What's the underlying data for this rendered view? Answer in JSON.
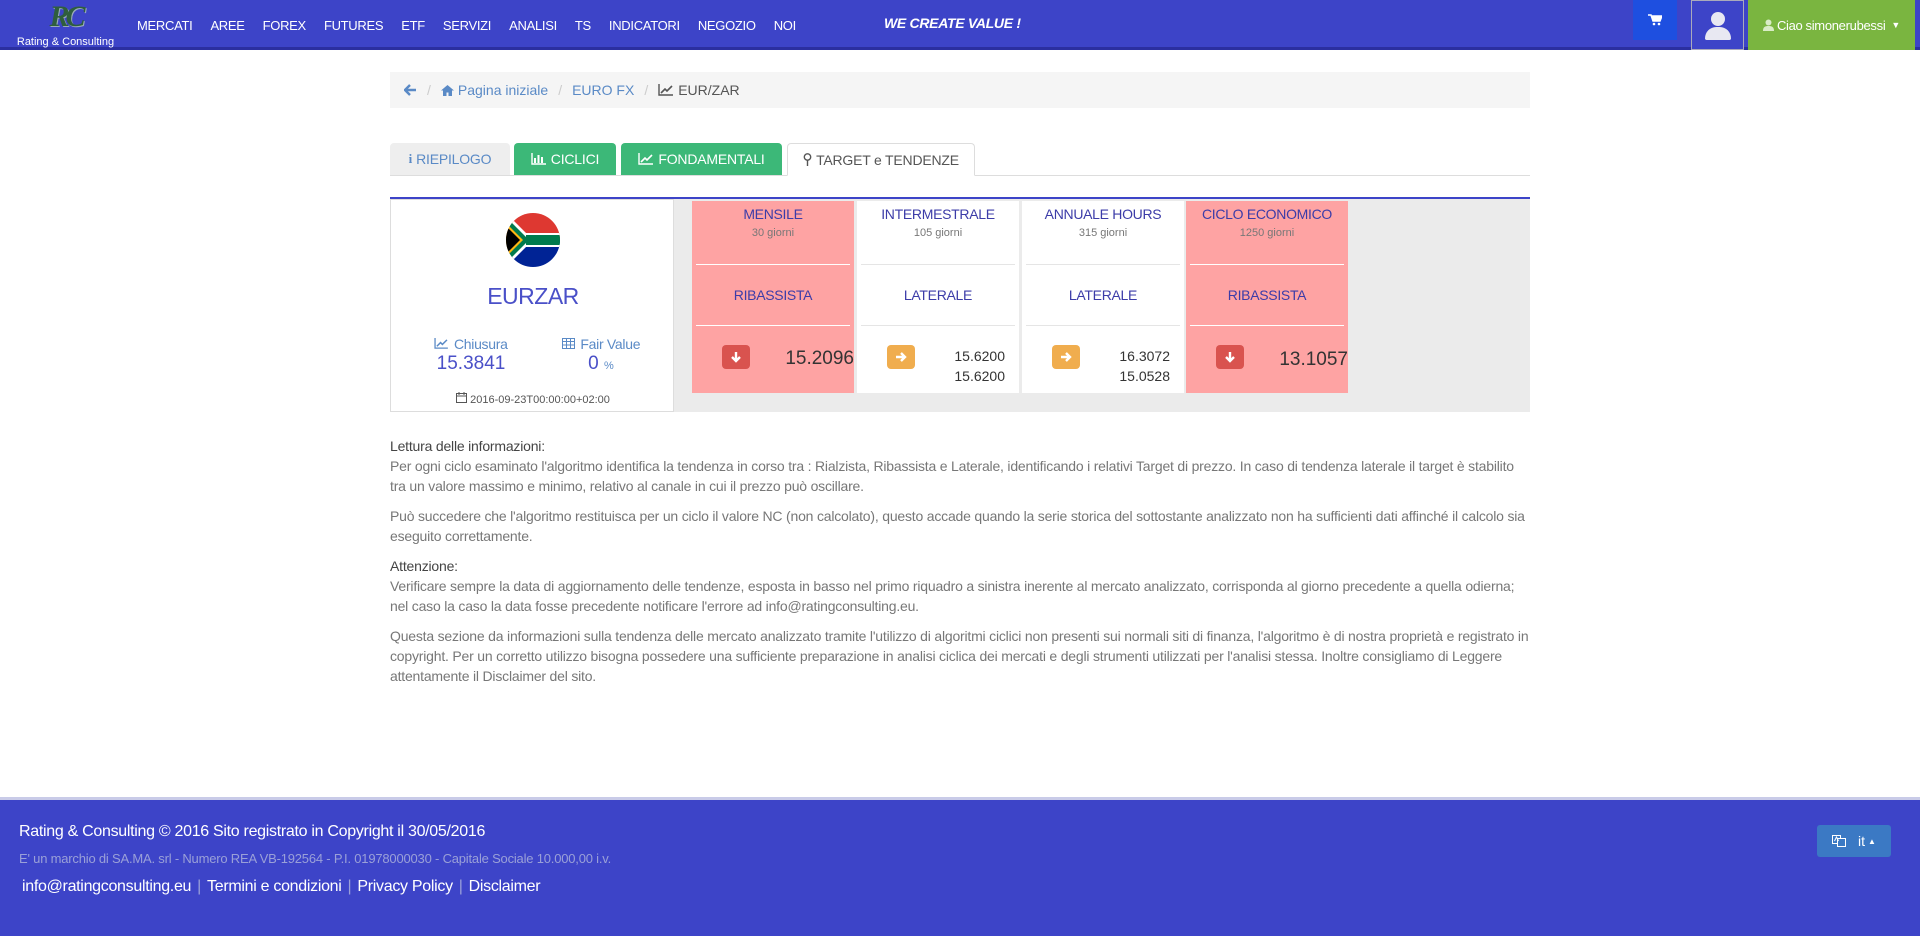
{
  "brand": {
    "logo_mark": "RC",
    "name": "Rating & Consulting"
  },
  "nav": [
    "MERCATI",
    "AREE",
    "FOREX",
    "FUTURES",
    "ETF",
    "SERVIZI",
    "ANALISI",
    "TS",
    "INDICATORI",
    "NEGOZIO",
    "NOI"
  ],
  "tagline": "WE CREATE VALUE !",
  "user": {
    "greeting": "Ciao",
    "username": "simonerubessi"
  },
  "breadcrumb": {
    "home": "Pagina iniziale",
    "section": "EURO FX",
    "current": "EUR/ZAR"
  },
  "tabs": {
    "riepilogo": "RIEPILOGO",
    "ciclici": "CICLICI",
    "fondamentali": "FONDAMENTALI",
    "target": "TARGET e TENDENZE"
  },
  "summary": {
    "ticker": "EURZAR",
    "close_label": "Chiusura",
    "close_value": "15.3841",
    "fair_label": "Fair Value",
    "fair_value": "0",
    "fair_unit": "%",
    "date": "2016-09-23T00:00:00+02:00"
  },
  "cycles": [
    {
      "title": "MENSILE",
      "sub": "30 giorni",
      "trend": "RIBASSISTA",
      "direction": "down",
      "value": "15.2096"
    },
    {
      "title": "INTERMESTRALE",
      "sub": "105 giorni",
      "trend": "LATERALE",
      "direction": "right",
      "v1": "15.6200",
      "v2": "15.6200"
    },
    {
      "title": "ANNUALE HOURS",
      "sub": "315 giorni",
      "trend": "LATERALE",
      "direction": "right",
      "v1": "16.3072",
      "v2": "15.0528"
    },
    {
      "title": "CICLO ECONOMICO",
      "sub": "1250 giorni",
      "trend": "RIBASSISTA",
      "direction": "down",
      "value": "13.1057"
    }
  ],
  "info": {
    "h1": "Lettura delle informazioni:",
    "p1": "Per ogni ciclo esaminato l'algoritmo identifica la tendenza in corso tra : Rialzista, Ribassista e Laterale, identificando i relativi Target di prezzo. In caso di tendenza laterale il target è stabilito tra un valore massimo e minimo, relativo al canale in cui il prezzo può oscillare.",
    "p2": "Può succedere che l'algoritmo restituisca per un ciclo il valore NC (non calcolato), questo accade quando la serie storica del sottostante analizzato non ha sufficienti dati affinché il calcolo sia eseguito correttamente.",
    "h2": "Attenzione:",
    "p3": "Verificare sempre la data di aggiornamento delle tendenze, esposta in basso nel primo riquadro a sinistra inerente al mercato analizzato, corrisponda al giorno precedente a quella odierna; nel caso la caso la data fosse precedente notificare l'errore ad info@ratingconsulting.eu.",
    "p4": "Questa sezione da informazioni sulla tendenza delle mercato analizzato tramite l'utilizzo di algoritmi ciclici non presenti sui normali siti di finanza, l'algoritmo è di nostra proprietà e registrato in copyright. Per un corretto utilizzo bisogna possedere una sufficiente preparazione in analisi ciclica dei mercati e degli strumenti utilizzati per l'analisi stessa. Inoltre consigliamo di Leggere attentamente il Disclaimer del sito."
  },
  "footer": {
    "line1": "Rating & Consulting © 2016 Sito registrato in Copyright il 30/05/2016",
    "line2": "E' un marchio di SA.MA. srl - Numero REA VB-192564 - P.I. 01978000030 - Capitale Sociale 10.000,00 i.v.",
    "email": "info@ratingconsulting.eu",
    "terms": "Termini e condizioni",
    "privacy": "Privacy Policy",
    "disclaimer": "Disclaimer",
    "lang": "it"
  },
  "colors": {
    "brand": "#3d44c8",
    "green": "#3cb878",
    "user_green": "#7ab540",
    "red_card": "#fea3a3",
    "down": "#d9534f",
    "lateral": "#f0ad4e"
  }
}
